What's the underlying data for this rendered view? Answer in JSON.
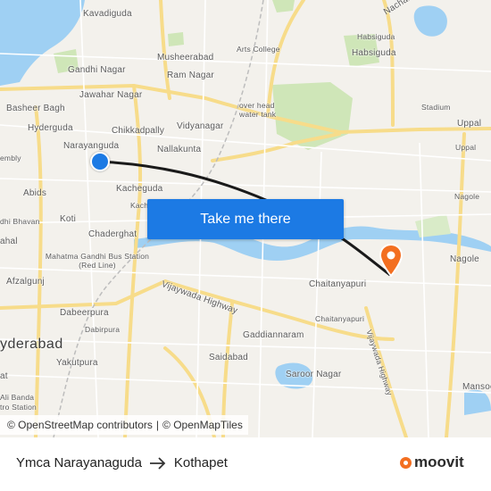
{
  "map": {
    "labels": [
      {
        "text": "Kavadiguda"
      },
      {
        "text": "Musheerabad"
      },
      {
        "text": "Arts College"
      },
      {
        "text": "Habsiguda"
      },
      {
        "text": "Habsiguda"
      },
      {
        "text": "Nacharam"
      },
      {
        "text": "Gandhi Nagar"
      },
      {
        "text": "Ram Nagar"
      },
      {
        "text": "Jawahar Nagar"
      },
      {
        "text": "Basheer Bagh"
      },
      {
        "text": "over head water tank"
      },
      {
        "text": "Stadium"
      },
      {
        "text": "Uppal"
      },
      {
        "text": "Uppal"
      },
      {
        "text": "Hyderguda"
      },
      {
        "text": "Chikkadpally"
      },
      {
        "text": "Vidyanagar"
      },
      {
        "text": "Narayanguda"
      },
      {
        "text": "Nallakunta"
      },
      {
        "text": "embly"
      },
      {
        "text": "Kacheguda"
      },
      {
        "text": "Abids"
      },
      {
        "text": "Nagole"
      },
      {
        "text": "dhi Bhavan"
      },
      {
        "text": "Koti"
      },
      {
        "text": "Kach"
      },
      {
        "text": "Chaderghat"
      },
      {
        "text": "ahal"
      },
      {
        "text": "Mahatma Gandhi Bus Station (Red Line)"
      },
      {
        "text": "Nagole"
      },
      {
        "text": "Afzalgunj"
      },
      {
        "text": "Chaitanyapuri"
      },
      {
        "text": "Vijaywada Highway"
      },
      {
        "text": "Dabeerpura"
      },
      {
        "text": "Chaitanyapuri"
      },
      {
        "text": "yderabad"
      },
      {
        "text": "Dabirpura"
      },
      {
        "text": "Gaddiannaram"
      },
      {
        "text": "Vijaywada Highway"
      },
      {
        "text": "Yakutpura"
      },
      {
        "text": "Saidabad"
      },
      {
        "text": "Saroor Nagar"
      },
      {
        "text": "at"
      },
      {
        "text": "Mansoo"
      },
      {
        "text": "Ali Banda tro Station"
      }
    ]
  },
  "cta_label": "Take me there",
  "attribution": {
    "osm": "© OpenStreetMap contributors",
    "sep": "|",
    "omt": "© OpenMapTiles"
  },
  "route": {
    "origin": "Ymca Narayanaguda",
    "destination": "Kothapet"
  },
  "brand": {
    "name": "moovit"
  },
  "colors": {
    "route_line": "#1a1a1a",
    "origin_marker": "#1c7ae4",
    "destination_marker": "#f36f21",
    "water": "#9fd0f3",
    "cta": "#1c7ae4"
  }
}
